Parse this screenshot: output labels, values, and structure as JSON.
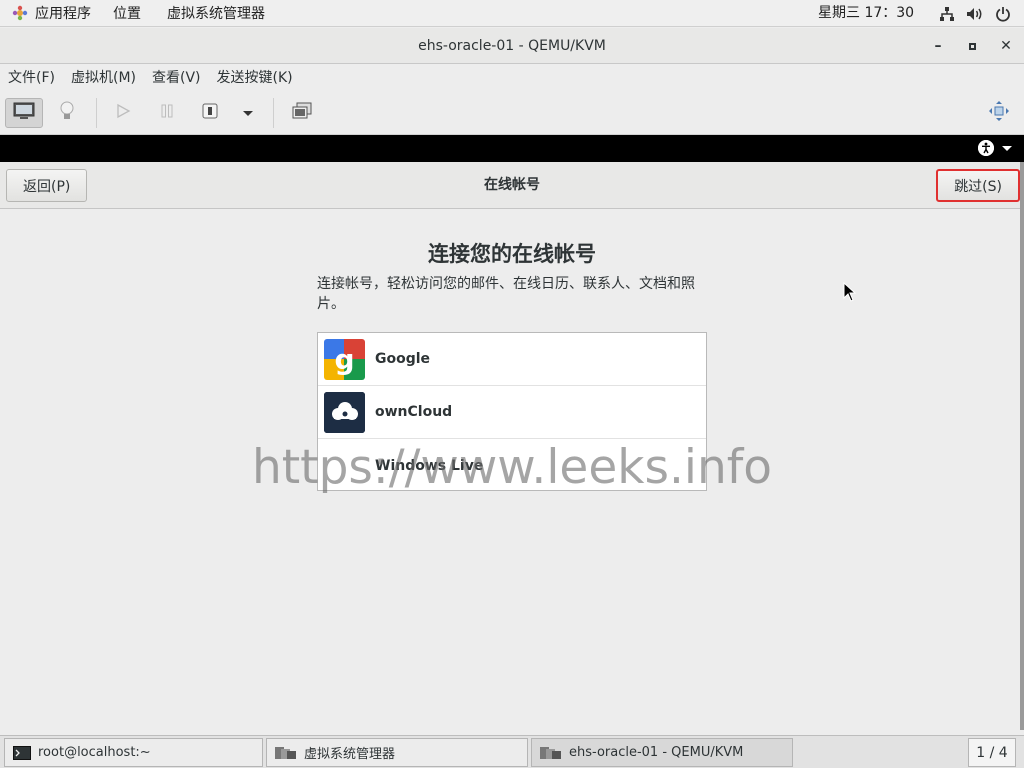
{
  "topbar": {
    "apps_label": "应用程序",
    "places_label": "位置",
    "active_app_label": "虚拟系统管理器",
    "clock": "星期三 17：30"
  },
  "window": {
    "title": "ehs-oracle-01 - QEMU/KVM",
    "minimize": "–",
    "maximize": "▫",
    "close": "✕"
  },
  "menubar": {
    "items": [
      {
        "label": "文件(F)"
      },
      {
        "label": "虚拟机(M)"
      },
      {
        "label": "查看(V)"
      },
      {
        "label": "发送按键(K)"
      }
    ]
  },
  "toolbar": {
    "icons": [
      "console-icon",
      "details-lightbulb-icon",
      "run-icon",
      "pause-icon",
      "shutdown-icon",
      "dropdown-arrow-icon",
      "snapshots-icon",
      "fullscreen-icon"
    ]
  },
  "guest": {
    "header": {
      "back_label": "返回(P)",
      "title": "在线帐号",
      "skip_label": "跳过(S)"
    },
    "heading": "连接您的在线帐号",
    "description": "连接帐号，轻松访问您的邮件、在线日历、联系人、文档和照片。",
    "accounts": [
      {
        "name": "Google",
        "icon": "google-icon"
      },
      {
        "name": "ownCloud",
        "icon": "owncloud-icon"
      },
      {
        "name": "Windows Live",
        "icon": "windows-live-icon"
      }
    ],
    "watermark": "https://www.leeks.info"
  },
  "taskbar": {
    "tasks": [
      {
        "label": "root@localhost:~",
        "icon": "terminal-icon"
      },
      {
        "label": "虚拟系统管理器",
        "icon": "virt-manager-icon"
      },
      {
        "label": "ehs-oracle-01 - QEMU/KVM",
        "icon": "virt-manager-icon"
      }
    ],
    "pager": "1 / 4"
  },
  "colors": {
    "skip_highlight": "#e03030",
    "guest_topbar": "#000000",
    "background": "#ededed"
  }
}
